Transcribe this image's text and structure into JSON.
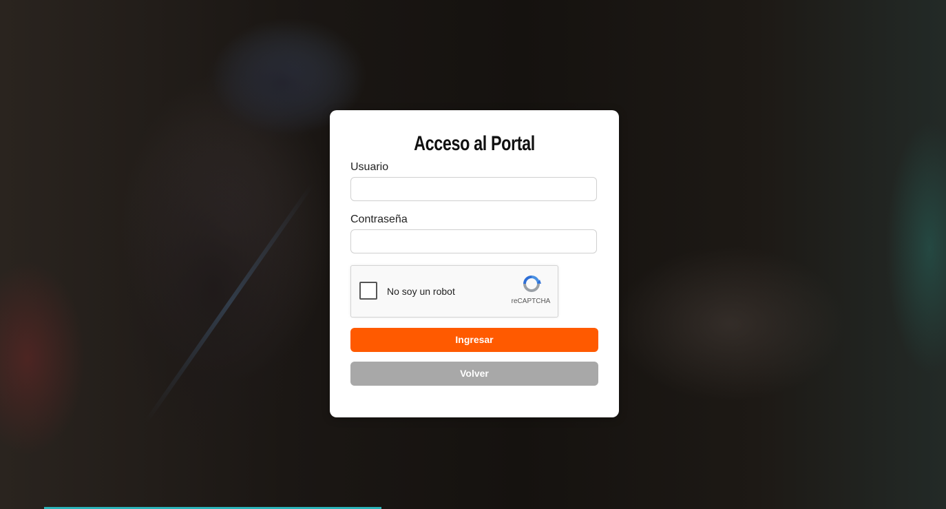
{
  "login": {
    "title": "Acceso al Portal",
    "username_label": "Usuario",
    "username_value": "",
    "password_label": "Contraseña",
    "password_value": "",
    "captcha_text": "No soy un robot",
    "captcha_brand": "reCAPTCHA",
    "submit_label": "Ingresar",
    "back_label": "Volver"
  },
  "colors": {
    "primary": "#ff5a00",
    "secondary": "#a8a8a8",
    "accent": "#2bb3b8"
  },
  "icons": {
    "captcha": "recaptcha-icon"
  }
}
